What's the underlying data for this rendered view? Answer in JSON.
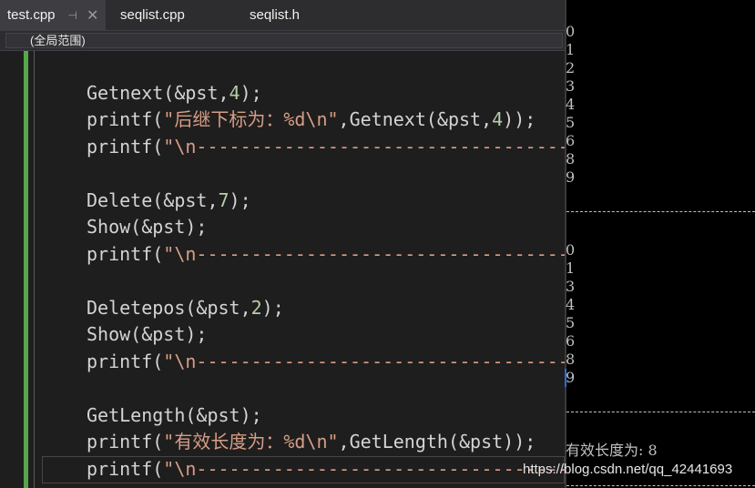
{
  "tabs": [
    {
      "label": "test.cpp",
      "active": true
    },
    {
      "label": "seqlist.cpp",
      "active": false
    },
    {
      "label": "seqlist.h",
      "active": false
    }
  ],
  "tab_icons": {
    "pin": "pin-icon",
    "close": "close-icon"
  },
  "scope": {
    "label": "(全局范围)"
  },
  "code_lines": [
    "Getnext(&pst,4);",
    "printf(\"后继下标为：%d\\n\",Getnext(&pst,4));",
    "printf(\"\\n-------------------------------------------",
    "",
    "Delete(&pst,7);",
    "Show(&pst);",
    "printf(\"\\n-------------------------------------------",
    "",
    "Deletepos(&pst,2);",
    "Show(&pst);",
    "printf(\"\\n-------------------------------------------",
    "",
    "GetLength(&pst);",
    "printf(\"有效长度为：%d\\n\",GetLength(&pst));",
    "printf(\"\\n-------------------------------------------"
  ],
  "console": {
    "block1": [
      "0",
      "1",
      "2",
      "3",
      "4",
      "5",
      "6",
      "8",
      "9"
    ],
    "block2": [
      "0",
      "1",
      "3",
      "4",
      "5",
      "6",
      "8",
      "9"
    ],
    "length_line": "有效长度为: 8"
  },
  "watermark": "https://blog.csdn.net/qq_42441693",
  "colors": {
    "editor_bg": "#1e1e1e",
    "console_bg": "#000000",
    "string": "#d69d85",
    "number": "#b5cea8",
    "change_bar": "#57a64a"
  }
}
